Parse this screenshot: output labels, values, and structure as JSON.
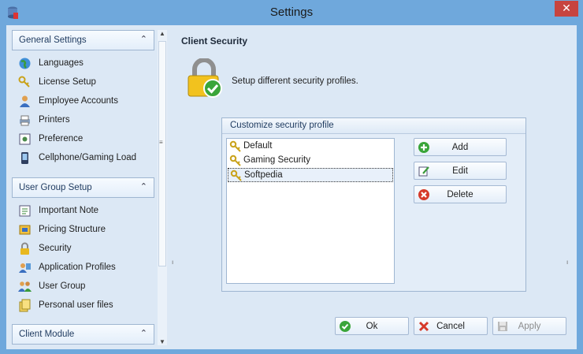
{
  "window": {
    "title": "Settings",
    "close_glyph": "✕",
    "app_icon": "database-icon"
  },
  "sidebar": {
    "sections": [
      {
        "label": "General Settings",
        "chevron": "⌃",
        "items": [
          {
            "label": "Languages",
            "icon": "globe-icon"
          },
          {
            "label": "License Setup",
            "icon": "keys-icon"
          },
          {
            "label": "Employee Accounts",
            "icon": "user-icon"
          },
          {
            "label": "Printers",
            "icon": "printer-icon"
          },
          {
            "label": "Preference",
            "icon": "preference-icon"
          },
          {
            "label": "Cellphone/Gaming Load",
            "icon": "phone-icon"
          }
        ]
      },
      {
        "label": "User Group Setup",
        "chevron": "⌃",
        "items": [
          {
            "label": "Important Note",
            "icon": "note-icon"
          },
          {
            "label": "Pricing Structure",
            "icon": "pricing-icon"
          },
          {
            "label": "Security",
            "icon": "lock-icon"
          },
          {
            "label": "Application Profiles",
            "icon": "app-profiles-icon"
          },
          {
            "label": "User Group",
            "icon": "user-group-icon"
          },
          {
            "label": "Personal user files",
            "icon": "files-icon"
          }
        ]
      },
      {
        "label": "Client Module",
        "chevron": "⌃",
        "items": []
      }
    ],
    "scroll": {
      "up": "▲",
      "down": "▼",
      "grip": "≡"
    }
  },
  "main": {
    "title": "Client Security",
    "description": "Setup different security profiles.",
    "group": {
      "title": "Customize security profile",
      "profiles": [
        "Default",
        "Gaming Security",
        "Softpedia"
      ],
      "selected_index": 2,
      "buttons": {
        "add": "Add",
        "edit": "Edit",
        "delete": "Delete"
      }
    },
    "footer": {
      "ok": "Ok",
      "cancel": "Cancel",
      "apply": "Apply"
    }
  },
  "colors": {
    "chrome": "#6fa8dc",
    "panel": "#dce8f5",
    "close": "#c7443f"
  }
}
